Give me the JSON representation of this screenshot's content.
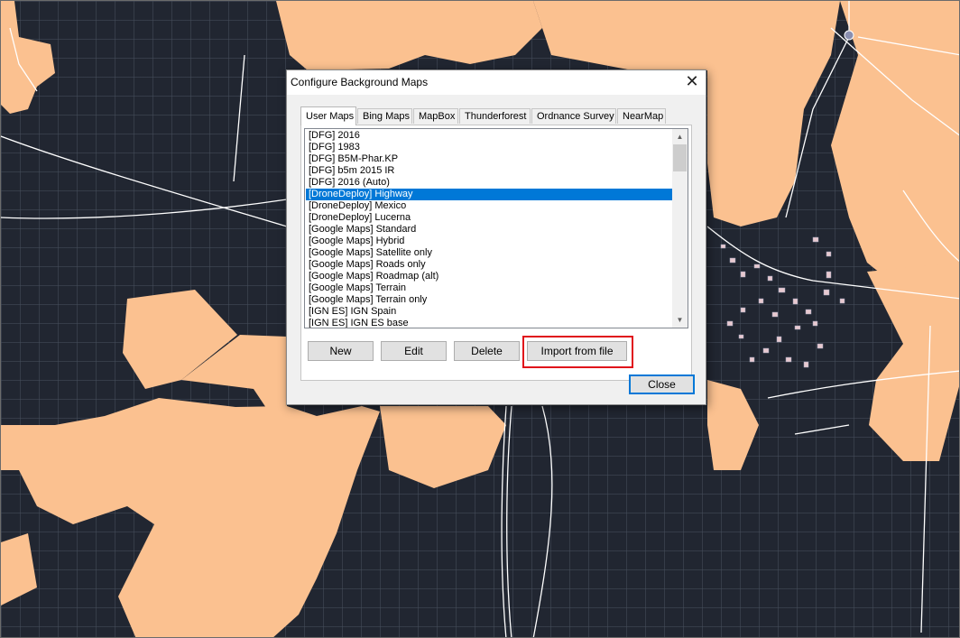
{
  "dialog": {
    "title": "Configure Background Maps",
    "close_glyph": "✕",
    "tabs": [
      {
        "label": "User Maps",
        "active": true
      },
      {
        "label": "Bing Maps",
        "active": false
      },
      {
        "label": "MapBox",
        "active": false
      },
      {
        "label": "Thunderforest",
        "active": false
      },
      {
        "label": "Ordnance Survey",
        "active": false
      },
      {
        "label": "NearMap",
        "active": false
      }
    ],
    "maps_list": {
      "items": [
        "[DFG] 2016",
        "[DFG] 1983",
        "[DFG] B5M-Phar.KP",
        "[DFG] b5m 2015 IR",
        "[DFG] 2016 (Auto)",
        "[DroneDeploy] Highway",
        "[DroneDeploy] Mexico",
        "[DroneDeploy] Lucerna",
        "[Google Maps] Standard",
        "[Google Maps] Hybrid",
        "[Google Maps] Satellite only",
        "[Google Maps] Roads only",
        "[Google Maps] Roadmap (alt)",
        "[Google Maps] Terrain",
        "[Google Maps] Terrain only",
        "[IGN ES] IGN Spain",
        "[IGN ES] IGN ES base"
      ],
      "selected": "[DroneDeploy] Highway",
      "scroll_up_glyph": "▲",
      "scroll_down_glyph": "▼"
    },
    "buttons": {
      "new": "New",
      "edit": "Edit",
      "delete": "Delete",
      "import": "Import from file",
      "close": "Close"
    },
    "highlighted_button": "Import from file"
  },
  "colors": {
    "map_background": "#212631",
    "land_fill": "#fbc190",
    "road_line": "#ffffff",
    "selection": "#0078d7",
    "highlight_border": "#e0101a"
  }
}
